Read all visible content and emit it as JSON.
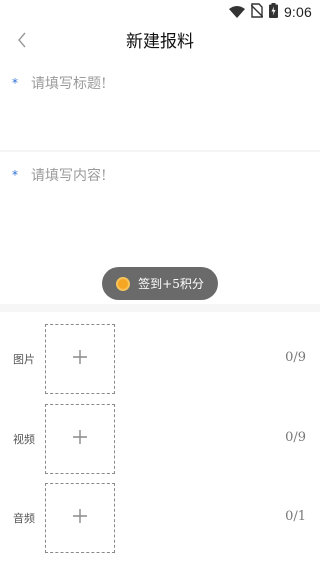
{
  "status_bar": {
    "time": "9:06",
    "icons": [
      "wifi-icon",
      "no-sim-icon",
      "battery-charging-icon"
    ]
  },
  "header": {
    "back_icon": "chevron-left-icon",
    "title": "新建报料"
  },
  "form": {
    "title_field": {
      "required_mark": "*",
      "placeholder": "请填写标题!"
    },
    "content_field": {
      "required_mark": "*",
      "placeholder": "请填写内容!"
    }
  },
  "toast": {
    "icon": "coin-icon",
    "text": "签到+5积分"
  },
  "media": [
    {
      "label": "图片",
      "count": "0/9",
      "add_icon": "plus-icon"
    },
    {
      "label": "视频",
      "count": "0/9",
      "add_icon": "plus-icon"
    },
    {
      "label": "音频",
      "count": "0/1",
      "add_icon": "plus-icon"
    }
  ],
  "colors": {
    "required_star": "#2f6fd6",
    "toast_bg": "#6a6a6a",
    "coin": "#f5a623",
    "placeholder": "#9b9b9b"
  }
}
